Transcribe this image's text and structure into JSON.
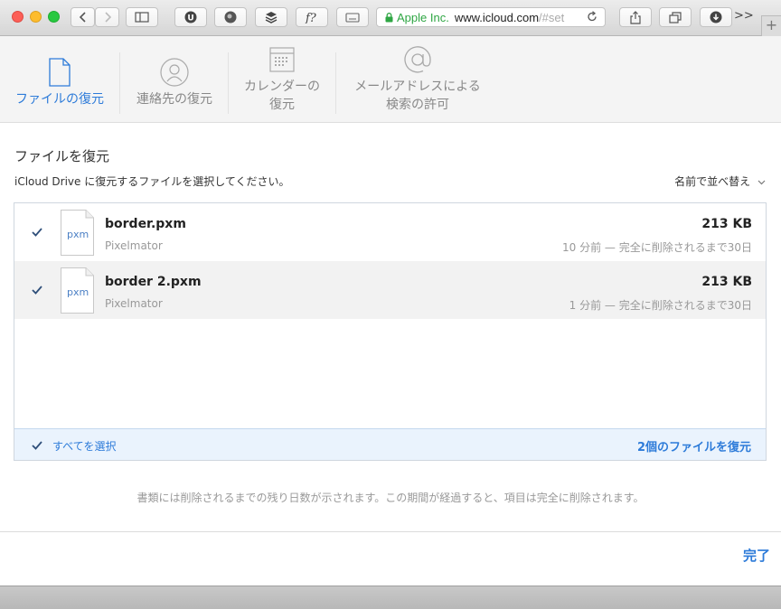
{
  "browser": {
    "url_company": "Apple Inc.",
    "url_host": "www.icloud.com",
    "url_path": "/#set",
    "more_label": ">>",
    "new_tab_label": "+"
  },
  "tabs": [
    {
      "label": "ファイルの復元",
      "icon": "file-icon",
      "active": true
    },
    {
      "label": "連絡先の復元",
      "icon": "contact-icon",
      "active": false
    },
    {
      "label_line1": "カレンダーの",
      "label_line2": "復元",
      "icon": "calendar-icon",
      "active": false
    },
    {
      "label_line1": "メールアドレスによる",
      "label_line2": "検索の許可",
      "icon": "at-icon",
      "active": false
    }
  ],
  "main": {
    "title": "ファイルを復元",
    "description": "iCloud Drive に復元するファイルを選択してください。",
    "sort_label": "名前で並べ替え"
  },
  "files": [
    {
      "name": "border.pxm",
      "app": "Pixelmator",
      "size": "213 KB",
      "status": "10 分前 — 完全に削除されるまで30日",
      "ext": "pxm",
      "checked": true
    },
    {
      "name": "border 2.pxm",
      "app": "Pixelmator",
      "size": "213 KB",
      "status": "1 分前 — 完全に削除されるまで30日",
      "ext": "pxm",
      "checked": true
    }
  ],
  "footer": {
    "select_all": "すべてを選択",
    "restore_button": "2個のファイルを復元"
  },
  "note": "書類には削除されるまでの残り日数が示されます。この期間が経過すると、項目は完全に削除されます。",
  "done_button": "完了",
  "colors": {
    "accent": "#2d7bd9",
    "url_green": "#2ea643"
  }
}
